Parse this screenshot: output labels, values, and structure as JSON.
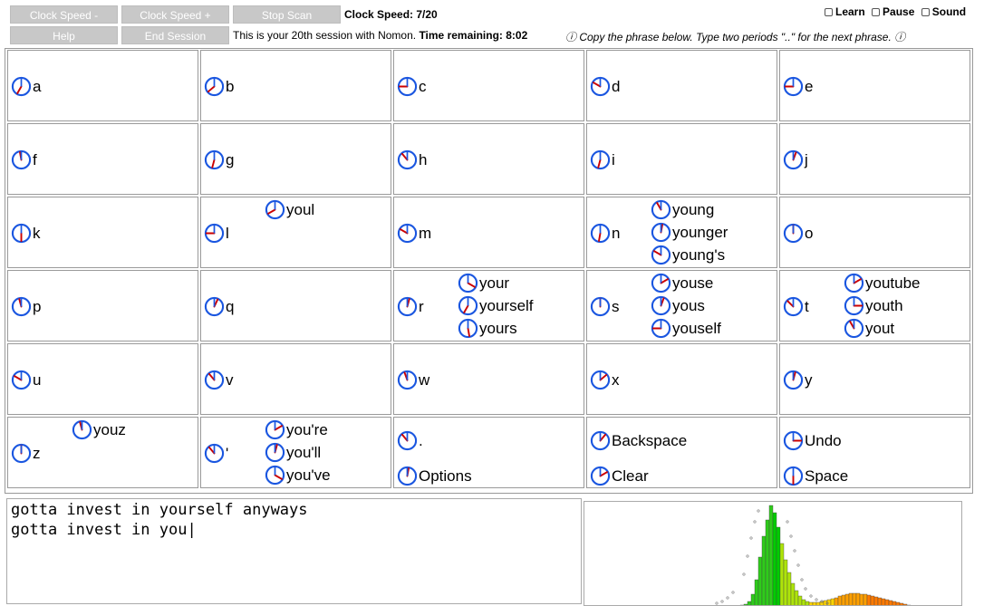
{
  "toolbar": {
    "clock_speed_down": "Clock Speed -",
    "clock_speed_up": "Clock Speed +",
    "stop_scan": "Stop Scan",
    "help": "Help",
    "end_session": "End Session",
    "clock_speed": "Clock Speed: 7/20",
    "session_text": "This is your 20th session with Nomon.",
    "time_remaining": "Time remaining: 8:02",
    "instruction": "ⓘ Copy the phrase below. Type two periods \"..\" for the next phrase. ⓘ",
    "learn": "Learn",
    "pause": "Pause",
    "sound": "Sound"
  },
  "colors": {
    "clock_blue": "#1a56e0",
    "hand_red": "#cc0000",
    "button_gray": "#c8c8c8"
  },
  "grid": [
    [
      {
        "main": {
          "label": "a",
          "angle": 210
        },
        "words": []
      },
      {
        "main": {
          "label": "b",
          "angle": 230
        },
        "words": []
      },
      {
        "main": {
          "label": "c",
          "angle": 270
        },
        "words": []
      },
      {
        "main": {
          "label": "d",
          "angle": 300
        },
        "words": []
      },
      {
        "main": {
          "label": "e",
          "angle": 270
        },
        "words": []
      }
    ],
    [
      {
        "main": {
          "label": "f",
          "angle": 350
        },
        "words": []
      },
      {
        "main": {
          "label": "g",
          "angle": 195
        },
        "words": []
      },
      {
        "main": {
          "label": "h",
          "angle": 320
        },
        "words": []
      },
      {
        "main": {
          "label": "i",
          "angle": 195
        },
        "words": []
      },
      {
        "main": {
          "label": "j",
          "angle": 20
        },
        "words": []
      }
    ],
    [
      {
        "main": {
          "label": "k",
          "angle": 180
        },
        "words": []
      },
      {
        "main": {
          "label": "l",
          "angle": 270
        },
        "words": [
          {
            "label": "youl",
            "angle": 240
          }
        ]
      },
      {
        "main": {
          "label": "m",
          "angle": 300
        },
        "words": []
      },
      {
        "main": {
          "label": "n",
          "angle": 190
        },
        "words": [
          {
            "label": "young",
            "angle": 330
          },
          {
            "label": "younger",
            "angle": 10
          },
          {
            "label": "young's",
            "angle": 300
          }
        ]
      },
      {
        "main": {
          "label": "o",
          "angle": 0
        },
        "words": []
      }
    ],
    [
      {
        "main": {
          "label": "p",
          "angle": 345
        },
        "words": []
      },
      {
        "main": {
          "label": "q",
          "angle": 25
        },
        "words": []
      },
      {
        "main": {
          "label": "r",
          "angle": 15
        },
        "words": [
          {
            "label": "your",
            "angle": 120
          },
          {
            "label": "yourself",
            "angle": 210
          },
          {
            "label": "yours",
            "angle": 170
          }
        ]
      },
      {
        "main": {
          "label": "s",
          "angle": 0
        },
        "words": [
          {
            "label": "youse",
            "angle": 60
          },
          {
            "label": "yous",
            "angle": 20
          },
          {
            "label": "youself",
            "angle": 270
          }
        ]
      },
      {
        "main": {
          "label": "t",
          "angle": 315
        },
        "words": [
          {
            "label": "youtube",
            "angle": 60
          },
          {
            "label": "youth",
            "angle": 90
          },
          {
            "label": "yout",
            "angle": 330
          }
        ]
      }
    ],
    [
      {
        "main": {
          "label": "u",
          "angle": 300
        },
        "words": []
      },
      {
        "main": {
          "label": "v",
          "angle": 320
        },
        "words": []
      },
      {
        "main": {
          "label": "w",
          "angle": 340
        },
        "words": []
      },
      {
        "main": {
          "label": "x",
          "angle": 50
        },
        "words": []
      },
      {
        "main": {
          "label": "y",
          "angle": 15
        },
        "words": []
      }
    ],
    [
      {
        "main": {
          "label": "z",
          "angle": 0
        },
        "words": [
          {
            "label": "youz",
            "angle": 345
          }
        ]
      },
      {
        "main": {
          "label": "'",
          "angle": 320
        },
        "words": [
          {
            "label": "you're",
            "angle": 60
          },
          {
            "label": "you'll",
            "angle": 15
          },
          {
            "label": "you've",
            "angle": 120
          }
        ]
      },
      {
        "main": {
          "label": ".",
          "angle": 320
        },
        "specials": [
          {
            "label": "Options",
            "angle": 10
          }
        ]
      },
      {
        "main": {
          "label": "Backspace",
          "angle": 40
        },
        "specials": [
          {
            "label": "Clear",
            "angle": 60
          }
        ]
      },
      {
        "main": {
          "label": "Undo",
          "angle": 90
        },
        "specials": [
          {
            "label": "Space",
            "angle": 180
          }
        ]
      }
    ]
  ],
  "text_area": {
    "line1": "gotta invest in yourself anyways",
    "line2": "gotta invest in you|"
  }
}
